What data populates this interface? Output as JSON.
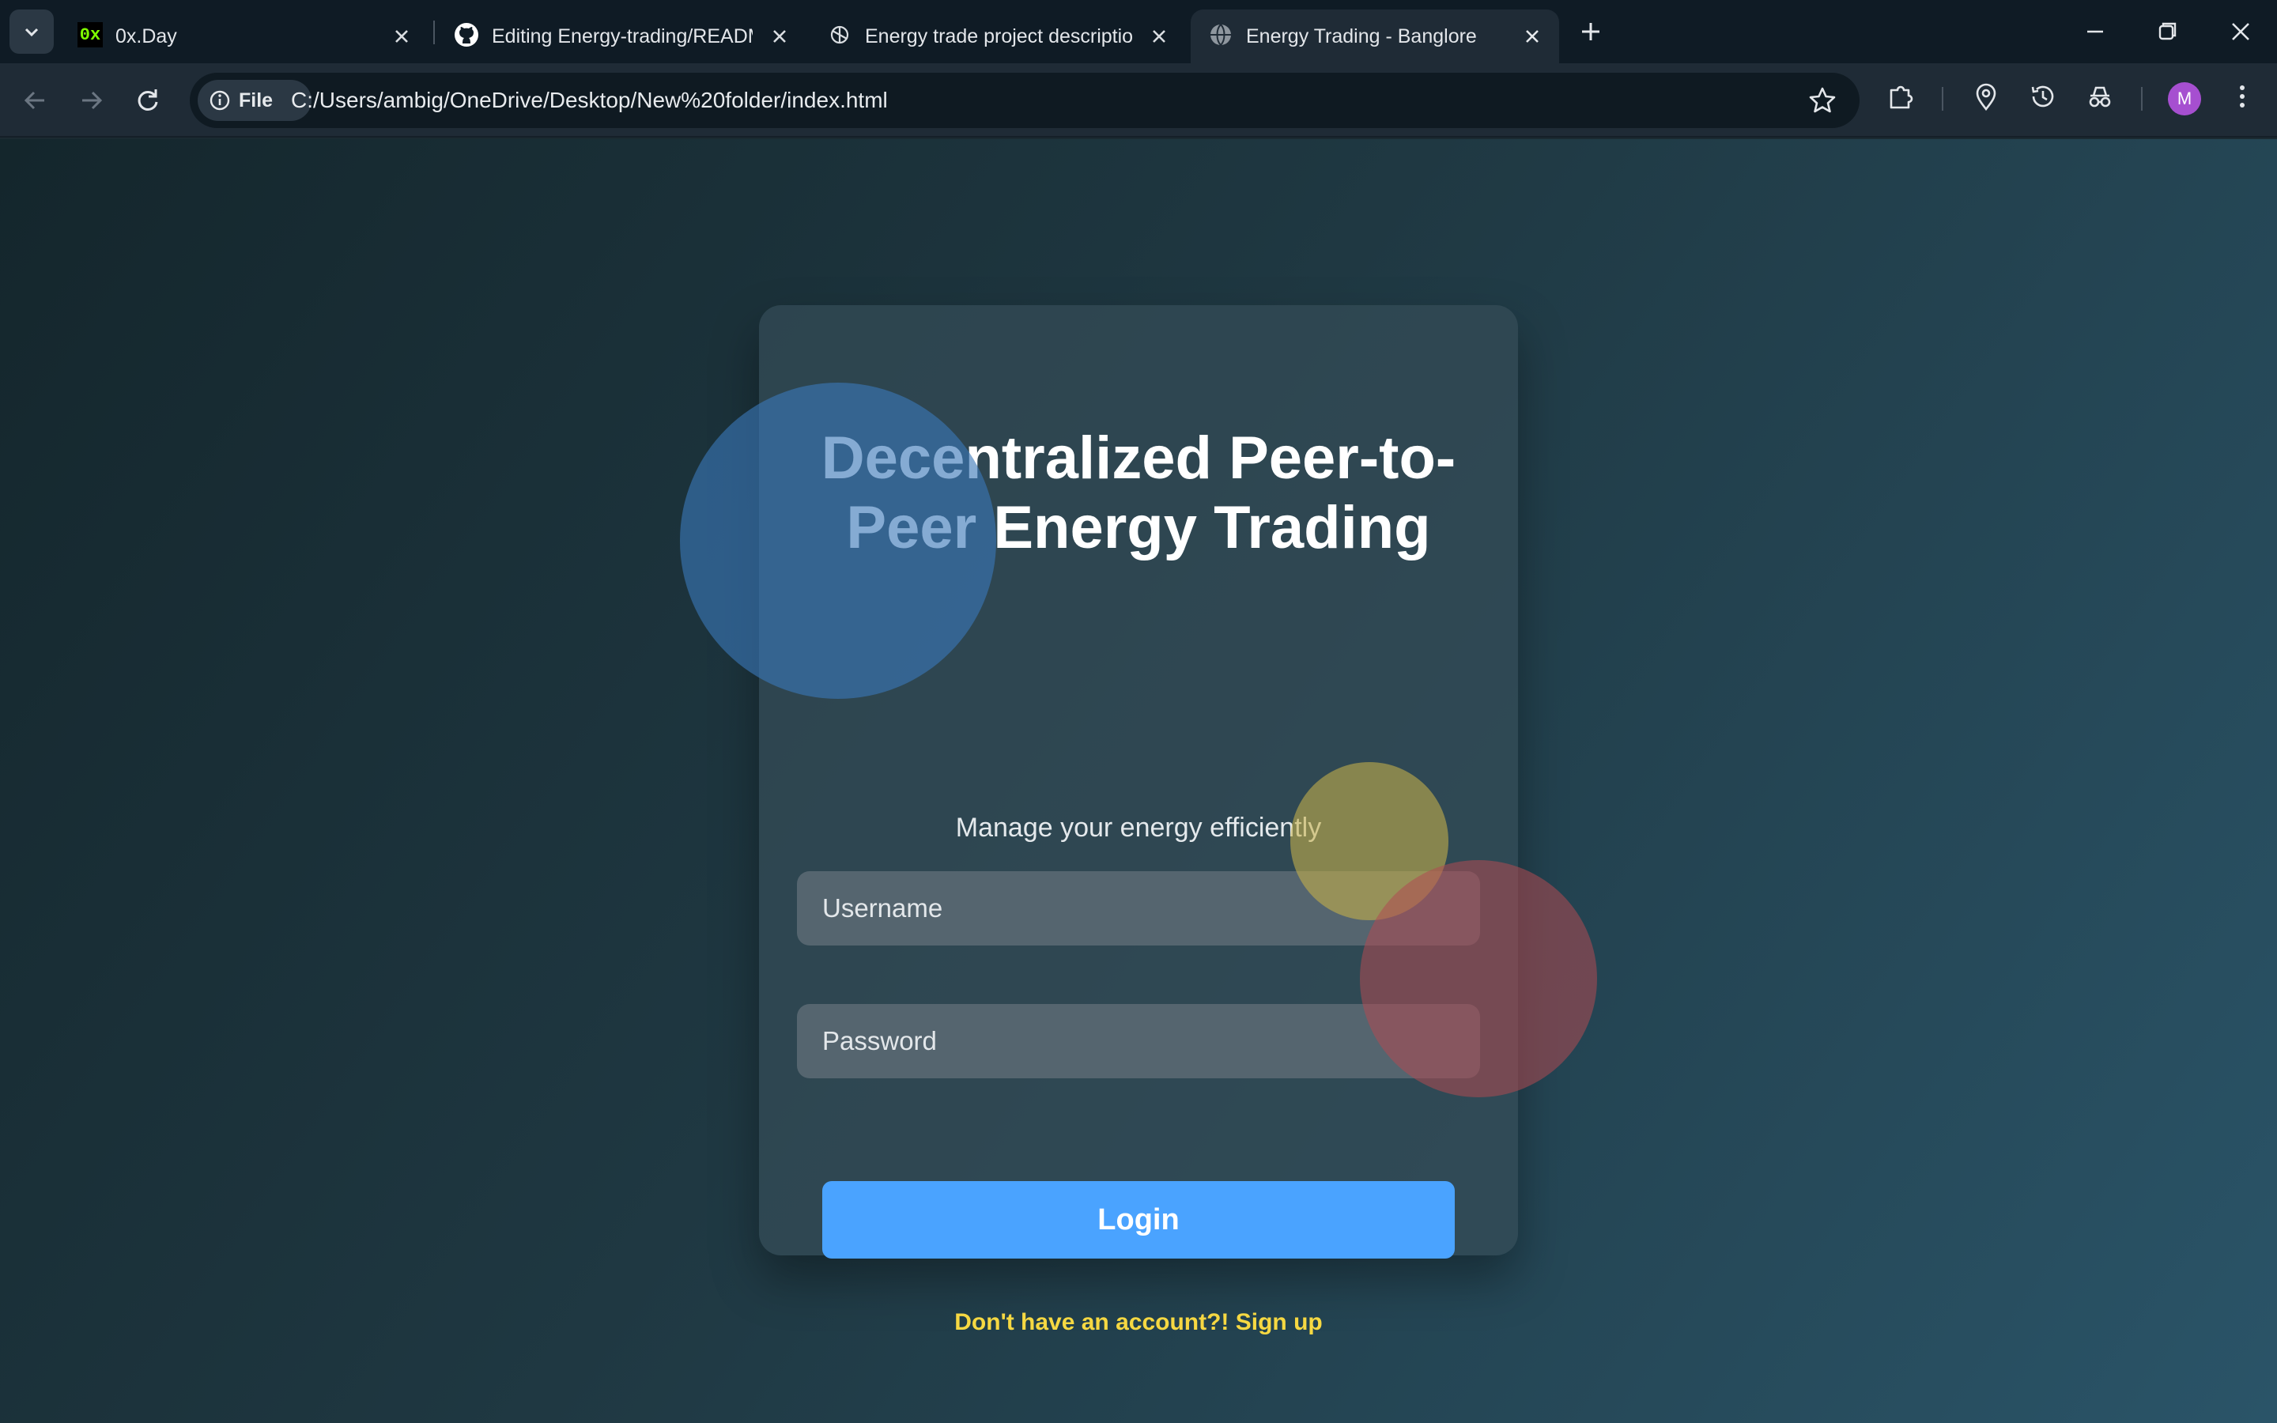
{
  "browser": {
    "tabs": [
      {
        "title": "0x.Day",
        "favicon": "0x-logo-icon"
      },
      {
        "title": "Editing Energy-trading/README",
        "favicon": "github-icon"
      },
      {
        "title": "Energy trade project description",
        "favicon": "openai-icon"
      },
      {
        "title": "Energy Trading - Banglore",
        "favicon": "globe-icon",
        "active": true
      }
    ],
    "favicon_0x_text": "0x",
    "chip_label": "File",
    "url": "C:/Users/ambig/OneDrive/Desktop/New%20folder/index.html",
    "profile_initial": "M"
  },
  "login": {
    "heading": "Decentralized Peer-to-Peer Energy Trading",
    "subtitle": "Manage your energy efficiently",
    "username_placeholder": "Username",
    "password_placeholder": "Password",
    "login_label": "Login",
    "signup_text": "Don't have an account?! Sign up"
  },
  "colors": {
    "accent_button": "#4aa3ff",
    "signup_link": "#f6d842",
    "bubble_blue": "#3a78b8",
    "bubble_yellow": "#c8b24a",
    "bubble_red": "#b04a52"
  }
}
